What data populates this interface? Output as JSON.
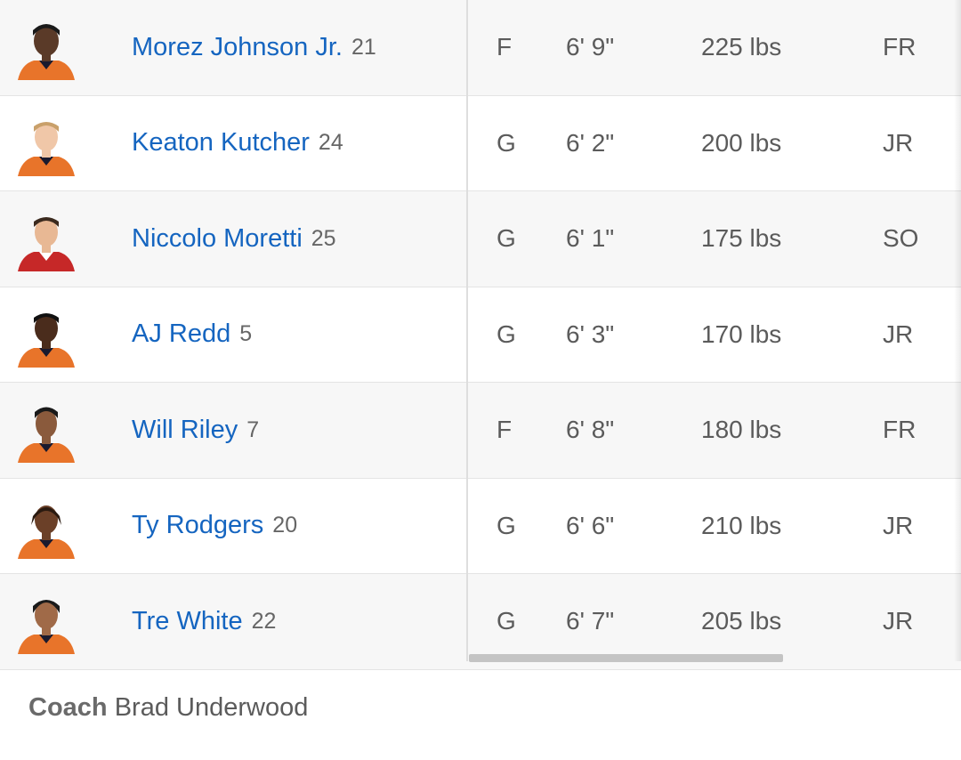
{
  "players": [
    {
      "name": "Morez Johnson Jr.",
      "number": "21",
      "position": "F",
      "height": "6' 9\"",
      "weight": "225 lbs",
      "year": "FR"
    },
    {
      "name": "Keaton Kutcher",
      "number": "24",
      "position": "G",
      "height": "6' 2\"",
      "weight": "200 lbs",
      "year": "JR"
    },
    {
      "name": "Niccolo Moretti",
      "number": "25",
      "position": "G",
      "height": "6' 1\"",
      "weight": "175 lbs",
      "year": "SO"
    },
    {
      "name": "AJ Redd",
      "number": "5",
      "position": "G",
      "height": "6' 3\"",
      "weight": "170 lbs",
      "year": "JR"
    },
    {
      "name": "Will Riley",
      "number": "7",
      "position": "F",
      "height": "6' 8\"",
      "weight": "180 lbs",
      "year": "FR"
    },
    {
      "name": "Ty Rodgers",
      "number": "20",
      "position": "G",
      "height": "6' 6\"",
      "weight": "210 lbs",
      "year": "JR"
    },
    {
      "name": "Tre White",
      "number": "22",
      "position": "G",
      "height": "6' 7\"",
      "weight": "205 lbs",
      "year": "JR"
    }
  ],
  "coach": {
    "label": "Coach",
    "name": "Brad Underwood"
  },
  "colors": {
    "link": "#1565c0",
    "jersey_orange": "#e8742a",
    "jersey_red": "#c62828"
  },
  "icons": {
    "avatar": "player-headshot-icon"
  }
}
